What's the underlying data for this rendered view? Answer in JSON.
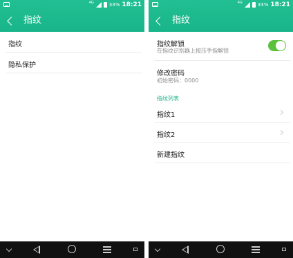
{
  "status_bar": {
    "network": "4G",
    "battery": "33%",
    "time": "18:21"
  },
  "left_screen": {
    "title": "指纹",
    "items": [
      {
        "label": "指纹"
      },
      {
        "label": "隐私保护"
      }
    ]
  },
  "right_screen": {
    "title": "指纹",
    "unlock": {
      "label": "指纹解锁",
      "description": "在指纹识别器上按压手指解锁",
      "enabled": true
    },
    "password": {
      "label": "修改密码",
      "description": "初始密码：0000"
    },
    "section_header": "指纹列表",
    "fingerprints": [
      {
        "label": "指纹1"
      },
      {
        "label": "指纹2"
      }
    ],
    "new_fingerprint": {
      "label": "新建指纹"
    }
  },
  "colors": {
    "header_green": "#1fba8e",
    "toggle_green": "#5cc13f",
    "section_accent": "#21b38a",
    "navbar": "#111111"
  },
  "icons": [
    "back-arrow-icon",
    "chevron-right-icon",
    "nav-back-icon",
    "nav-home-icon",
    "nav-menu-icon"
  ]
}
